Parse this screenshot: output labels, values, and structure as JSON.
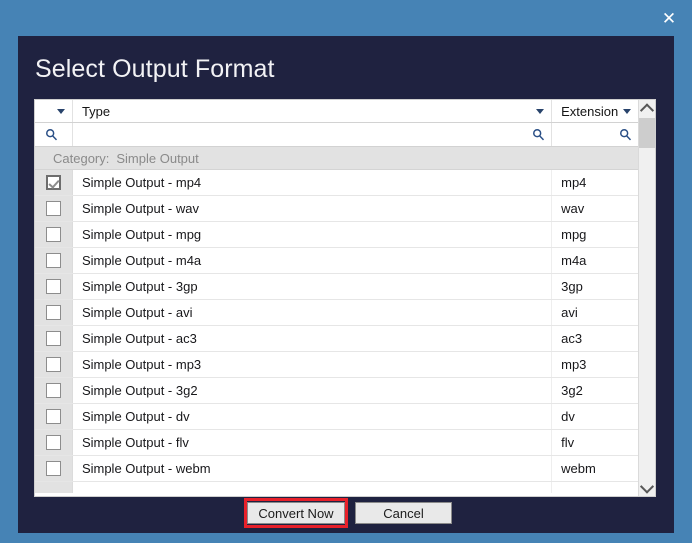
{
  "window": {
    "close_icon": "close-icon",
    "close_glyph": "✕",
    "chrome_color": "#4683b5",
    "panel_color": "#1f2240"
  },
  "dialog": {
    "title": "Select Output Format"
  },
  "grid": {
    "columns": [
      {
        "key": "check",
        "label": "",
        "has_caret": true
      },
      {
        "key": "type",
        "label": "Type",
        "has_caret": true
      },
      {
        "key": "extension",
        "label": "Extension",
        "has_caret": true
      }
    ],
    "filter_row": {
      "check_icon": "search-icon",
      "type_icon": "search-icon",
      "extension_icon": "search-icon",
      "type_value": "",
      "extension_value": ""
    },
    "group": {
      "key_label": "Category:",
      "value_label": "Simple Output"
    },
    "rows": [
      {
        "checked": true,
        "type": "Simple Output - mp4",
        "extension": "mp4"
      },
      {
        "checked": false,
        "type": "Simple Output - wav",
        "extension": "wav"
      },
      {
        "checked": false,
        "type": "Simple Output - mpg",
        "extension": "mpg"
      },
      {
        "checked": false,
        "type": "Simple Output - m4a",
        "extension": "m4a"
      },
      {
        "checked": false,
        "type": "Simple Output - 3gp",
        "extension": "3gp"
      },
      {
        "checked": false,
        "type": "Simple Output - avi",
        "extension": "avi"
      },
      {
        "checked": false,
        "type": "Simple Output - ac3",
        "extension": "ac3"
      },
      {
        "checked": false,
        "type": "Simple Output - mp3",
        "extension": "mp3"
      },
      {
        "checked": false,
        "type": "Simple Output - 3g2",
        "extension": "3g2"
      },
      {
        "checked": false,
        "type": "Simple Output - dv",
        "extension": "dv"
      },
      {
        "checked": false,
        "type": "Simple Output - flv",
        "extension": "flv"
      },
      {
        "checked": false,
        "type": "Simple Output - webm",
        "extension": "webm"
      }
    ],
    "scrollbar": {
      "up_icon": "chevron-up-icon",
      "down_icon": "chevron-down-icon",
      "thumb_name": "scrollbar-thumb"
    }
  },
  "footer": {
    "convert_label": "Convert Now",
    "cancel_label": "Cancel",
    "highlight_color": "#e8202a"
  }
}
